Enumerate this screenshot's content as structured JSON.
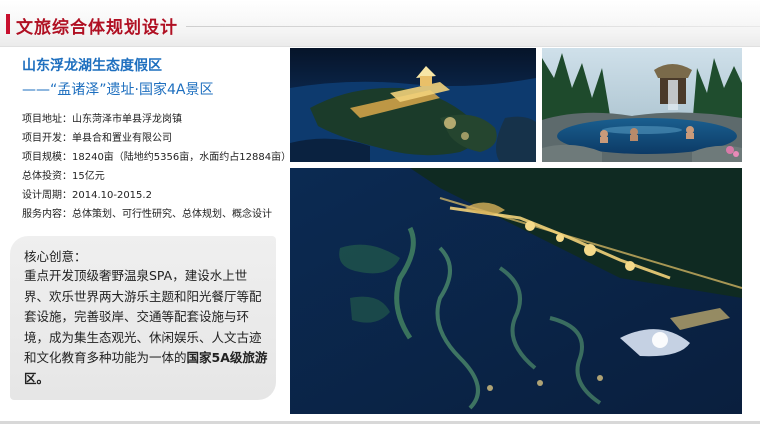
{
  "header": {
    "title": "文旅综合体规划设计"
  },
  "project": {
    "title": "山东浮龙湖生态度假区",
    "subtitle": "——“孟诸泽”遗址·国家4A景区",
    "info": [
      {
        "label": "项目地址：",
        "value": "山东菏泽市单县浮龙岗镇"
      },
      {
        "label": "项目开发：",
        "value": "单县合和置业有限公司"
      },
      {
        "label": "项目规模：",
        "value": "18240亩（陆地约5356亩，水面约占12884亩）"
      },
      {
        "label": "总体投资：",
        "value": "15亿元"
      },
      {
        "label": "设计周期：",
        "value": "2014.10-2015.2"
      },
      {
        "label": "服务内容：",
        "value": "总体策划、可行性研究、总体规划、概念设计"
      }
    ]
  },
  "creative": {
    "heading": "核心创意：",
    "text": "重点开发顶级奢野温泉SPA，建设水上世界、欢乐世界两大游乐主题和阳光餐厅等配套设施，完善驳岸、交通等配套设施与环境，成为集生态观光、休闲娱乐、人文古迹和文化教育多种功能为一体的",
    "emphasis": "国家5A级旅游区。"
  },
  "colors": {
    "accent_red": "#b01023",
    "title_blue": "#1e6fbf"
  }
}
